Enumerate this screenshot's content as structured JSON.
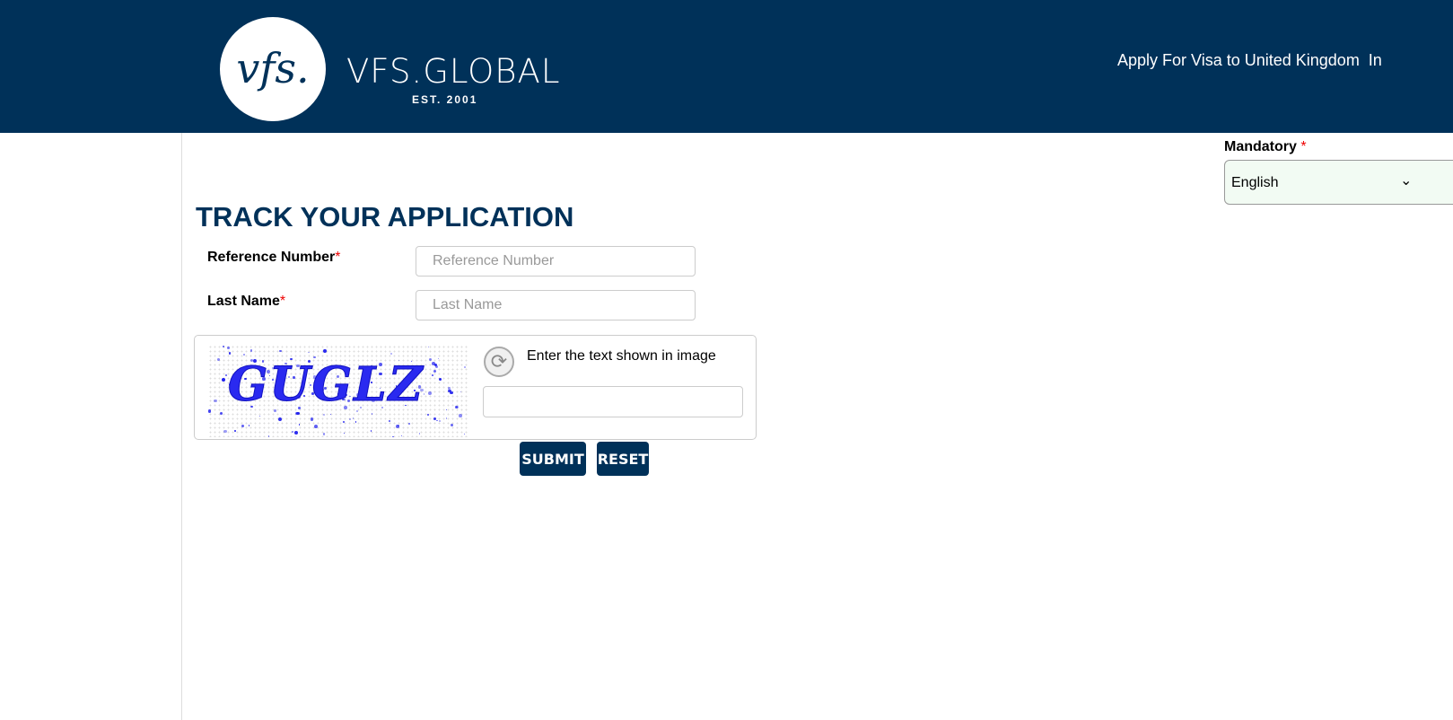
{
  "header": {
    "logo_mark": "vfs.",
    "brand": "VFS.GLOBAL",
    "est": "EST. 2001",
    "apply_text": "Apply For Visa to United Kingdom  In",
    "bg_color": "#003159"
  },
  "language": {
    "label": "Mandatory",
    "required": "*",
    "selected": "English"
  },
  "page_title": "TRACK YOUR APPLICATION",
  "form": {
    "reference": {
      "label": "Reference Number",
      "required": "*",
      "placeholder": "Reference Number",
      "value": ""
    },
    "last_name": {
      "label": "Last Name",
      "required": "*",
      "placeholder": "Last Name",
      "value": ""
    }
  },
  "captcha": {
    "image_text": "GUGLZ",
    "prompt": "Enter the text shown in image",
    "value": "",
    "refresh_icon": "refresh-icon"
  },
  "buttons": {
    "submit": "SUBMIT",
    "reset": "RESET"
  }
}
